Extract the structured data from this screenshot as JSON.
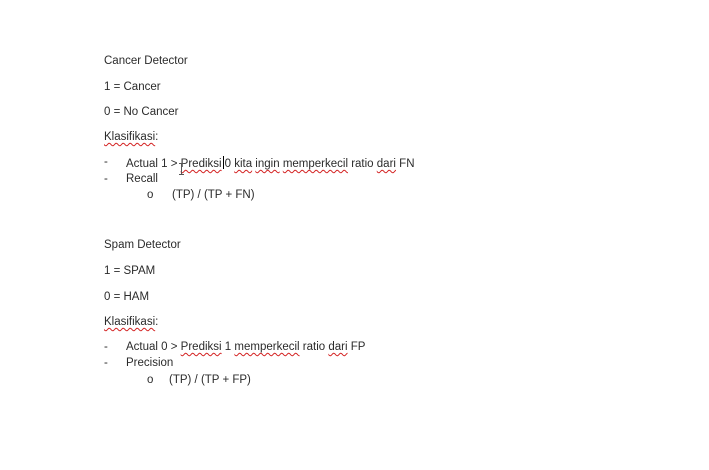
{
  "section1": {
    "title": "Cancer Detector",
    "line1": "1 = Cancer",
    "line2": "0 = No Cancer",
    "klasifikasi": "Klasifikasi",
    "klas_colon": ":",
    "bullet1": {
      "dash": "-",
      "pre": "Actual 1 >",
      "w1": "Prediksi",
      "mid": "0",
      "w2": "kita",
      "w3": "ingin",
      "w4": "memperkecil",
      "rest": "ratio",
      "w5": "dari",
      "end": "FN"
    },
    "bullet2": {
      "dash": "-",
      "text": "Recall"
    },
    "sub": {
      "circle": "o",
      "text": "(TP) / (TP + FN)"
    }
  },
  "section2": {
    "title": "Spam Detector",
    "line1": "1 = SPAM",
    "line2": "0 = HAM",
    "klasifikasi": "Klasifikasi",
    "klas_colon": ":",
    "bullet1": {
      "dash": "-",
      "pre": "Actual 0 >",
      "w1": "Prediksi",
      "mid": "1",
      "w2": "memperkecil",
      "rest": "ratio",
      "w3": "dari",
      "end": "FP"
    },
    "bullet2": {
      "dash": "-",
      "text": "Precision"
    },
    "sub": {
      "circle": "o",
      "text": "(TP) / (TP + FP)"
    }
  }
}
